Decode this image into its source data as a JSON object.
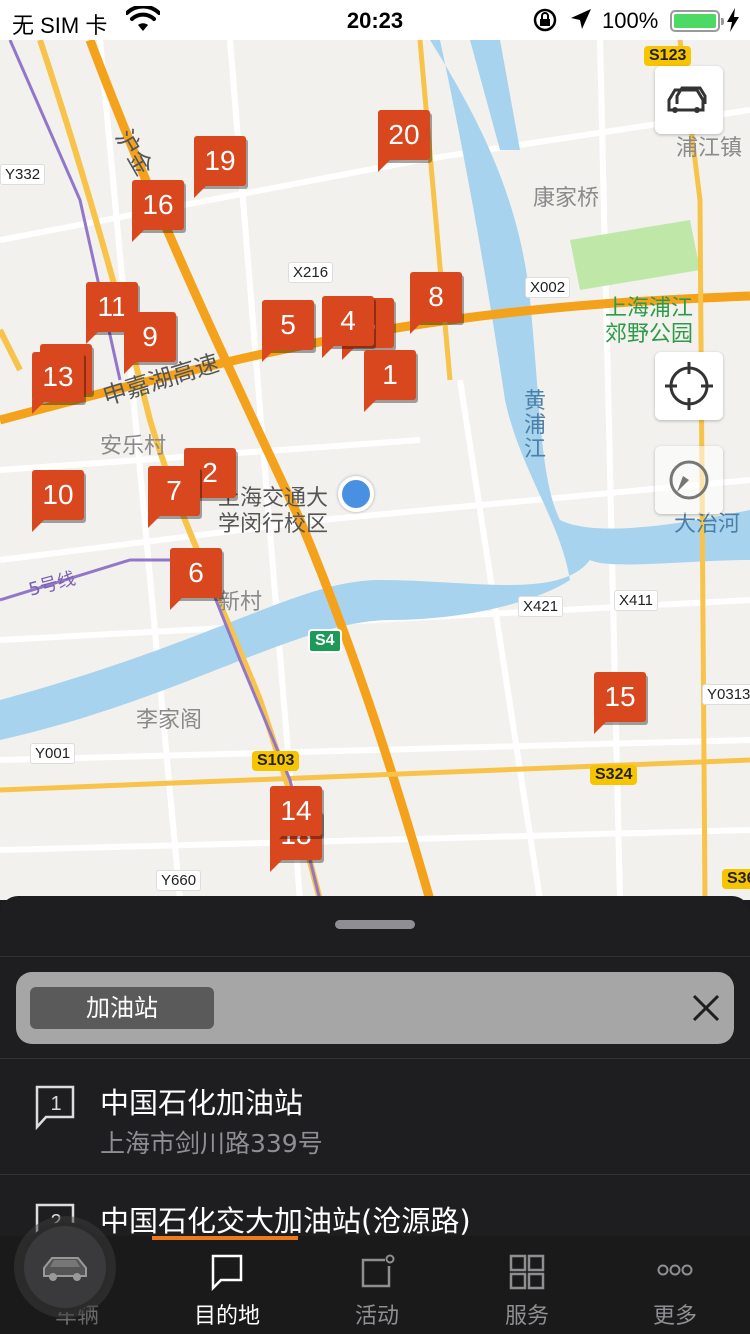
{
  "status_bar": {
    "carrier": "无 SIM 卡",
    "time": "20:23",
    "battery_percent": "100%",
    "battery_level": 1.0,
    "battery_color": "#4cd964"
  },
  "map": {
    "labels": {
      "yhu_jin": "沪金",
      "kangjiaqiao": "康家桥",
      "pujiangzhen": "浦江镇",
      "park_line1": "上海浦江",
      "park_line2": "郊野公园",
      "hj_highway": "申嘉湖高速",
      "anle": "安乐村",
      "sjtu_line1": "上海交通大",
      "sjtu_line2": "学闵行校区",
      "huangpu": "黄浦江",
      "xincun": "新村",
      "line5": "5号线",
      "lijiage": "李家阁",
      "dazhihe": "大治河"
    },
    "road_tags": {
      "y332": "Y332",
      "x216": "X216",
      "x002": "X002",
      "x421": "X421",
      "x411": "X411",
      "y0313": "Y0313",
      "y001": "Y001",
      "y660": "Y660"
    },
    "shields": {
      "s123": "S123",
      "s4": "S4",
      "s103": "S103",
      "s324": "S324",
      "s36": "S36"
    },
    "pins": [
      "1",
      "2",
      "3",
      "4",
      "5",
      "6",
      "7",
      "8",
      "9",
      "10",
      "11",
      "12",
      "13",
      "14",
      "15",
      "16",
      "18",
      "19",
      "20"
    ]
  },
  "search": {
    "chip_label": "加油站",
    "clear_icon": "close-icon"
  },
  "results": [
    {
      "index": "1",
      "title": "中国石化加油站",
      "address": "上海市剑川路339号"
    },
    {
      "index": "2",
      "title": "中国石化交大加油站(沧源路)",
      "address": ""
    }
  ],
  "tabbar": {
    "tabs": [
      {
        "label": "车辆",
        "icon": "car-icon"
      },
      {
        "label": "目的地",
        "icon": "flag-icon",
        "active": true
      },
      {
        "label": "活动",
        "icon": "activity-icon"
      },
      {
        "label": "服务",
        "icon": "grid-icon"
      },
      {
        "label": "更多",
        "icon": "more-icon"
      }
    ],
    "accent": "#f07a1a"
  }
}
